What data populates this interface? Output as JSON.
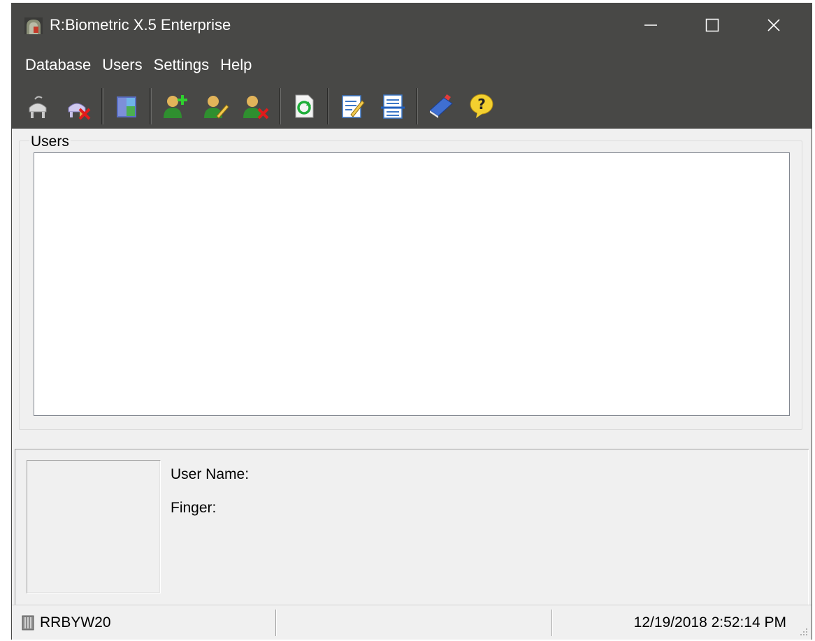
{
  "window": {
    "title": "R:Biometric X.5 Enterprise",
    "controls": [
      "minimize",
      "maximize",
      "close"
    ]
  },
  "menu": [
    "Database",
    "Users",
    "Settings",
    "Help"
  ],
  "toolbar": {
    "buttons": [
      {
        "icon": "scanner-connect-icon"
      },
      {
        "icon": "scanner-disconnect-icon"
      },
      {
        "icon": "door-icon"
      },
      {
        "icon": "add-user-icon"
      },
      {
        "icon": "edit-user-icon"
      },
      {
        "icon": "delete-user-icon"
      },
      {
        "icon": "refresh-icon"
      },
      {
        "icon": "edit-document-icon"
      },
      {
        "icon": "list-document-icon"
      },
      {
        "icon": "book-icon"
      },
      {
        "icon": "help-icon"
      }
    ]
  },
  "users_panel": {
    "legend": "Users",
    "items": []
  },
  "details": {
    "user_name_label": "User Name:",
    "user_name_value": "",
    "finger_label": "Finger:",
    "finger_value": ""
  },
  "statusbar": {
    "device": "RRBYW20",
    "middle": "",
    "datetime": "12/19/2018 2:52:14 PM"
  },
  "colors": {
    "titlebar_bg": "#484846",
    "panel_bg": "#f0f0f0",
    "list_bg": "#ffffff"
  }
}
